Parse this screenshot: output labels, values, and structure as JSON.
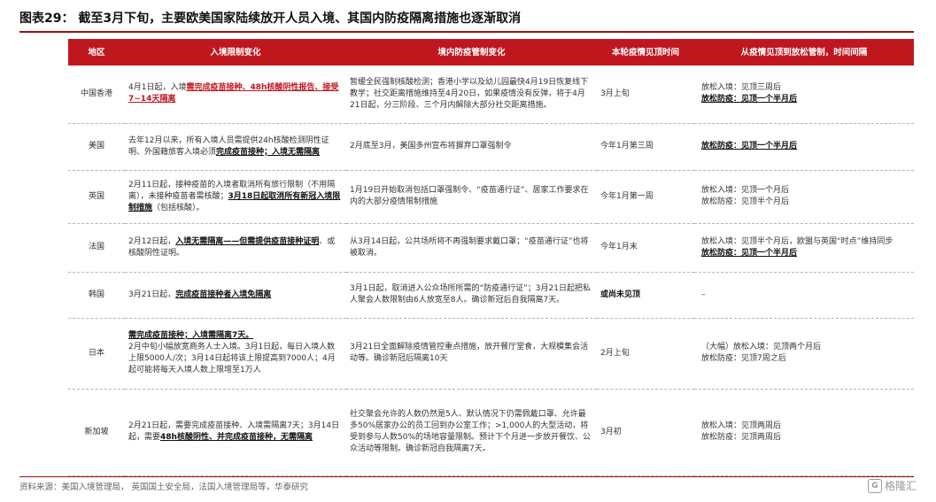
{
  "title": "图表29： 截至3月下旬，主要欧美国家陆续放开人员入境、其国内防疫隔离措施也逐渐取消",
  "headers": [
    "地区",
    "入境限制变化",
    "境内防疫管制变化",
    "本轮疫情见顶时间",
    "从疫情见顶到放松管制，时间间隔"
  ],
  "rows": [
    {
      "region": "中国香港",
      "entry": [
        {
          "t": "4月1日起，入境",
          "s": ""
        },
        {
          "t": "需完成疫苗接种、48h核酸阴性报告、接受7~14天隔离",
          "s": "r"
        }
      ],
      "domestic": [
        {
          "t": "暂缓全民强制核酸检测；香港小学以及幼儿园最快4月19日恢复线下教学；社交距离措施维持至4月20日，如果疫情没有反弹，将于4月21日起，分三阶段、三个月内解除大部分社交距离措施。",
          "s": ""
        }
      ],
      "peak": [
        {
          "t": "3月上旬",
          "s": ""
        }
      ],
      "interval": [
        {
          "t": "放松入境：见顶三周后",
          "s": ""
        },
        {
          "t": "放松防疫：见顶一个半月后",
          "s": "u",
          "br": true
        }
      ]
    },
    {
      "region": "美国",
      "entry": [
        {
          "t": "去年12月以来，所有入境人员需提供24h核酸检测阴性证明、外国籍旅客入境必须",
          "s": ""
        },
        {
          "t": "完成疫苗接种；入境无需隔离",
          "s": "u"
        }
      ],
      "domestic": [
        {
          "t": "2月底至3月，美国多州宣布将摒弃口罩强制令",
          "s": ""
        }
      ],
      "peak": [
        {
          "t": "今年1月第三周",
          "s": ""
        }
      ],
      "interval": [
        {
          "t": "放松防疫：见顶一个半月后",
          "s": "u"
        }
      ]
    },
    {
      "region": "英国",
      "entry": [
        {
          "t": "2月11日起，接种疫苗的入境者取消所有旅行限制（不用隔离），未接种疫苗者需核酸；",
          "s": ""
        },
        {
          "t": "3月18日起取消所有新冠入境限制措施",
          "s": "u"
        },
        {
          "t": "（包括核酸）。",
          "s": ""
        }
      ],
      "domestic": [
        {
          "t": "1月19日开始取消包括口罩强制令、“疫苗通行证”、居家工作要求在内的大部分疫情限制措施",
          "s": ""
        }
      ],
      "peak": [
        {
          "t": "今年1月第一周",
          "s": ""
        }
      ],
      "interval": [
        {
          "t": "放松入境：见顶一个月后",
          "s": ""
        },
        {
          "t": "放松防疫：见顶半个月后",
          "s": "",
          "br": true
        }
      ]
    },
    {
      "region": "法国",
      "entry": [
        {
          "t": "2月12日起，",
          "s": ""
        },
        {
          "t": "入境无需隔离——但需提供疫苗接种证明",
          "s": "u"
        },
        {
          "t": "、或核酸阴性证明。",
          "s": ""
        }
      ],
      "domestic": [
        {
          "t": "从3月14日起，公共场所将不再强制要求戴口罩；“疫苗通行证”也将被取消。",
          "s": ""
        }
      ],
      "peak": [
        {
          "t": "今年1月末",
          "s": ""
        }
      ],
      "interval": [
        {
          "t": "放松入境：见顶半个月后，欧盟与英国“时点”维持同步",
          "s": ""
        },
        {
          "t": "放松防疫：见顶一个半月后",
          "s": "u",
          "br": true
        }
      ]
    },
    {
      "region": "韩国",
      "entry": [
        {
          "t": "3月21日起，",
          "s": ""
        },
        {
          "t": "完成疫苗接种者入境免隔离",
          "s": "u"
        }
      ],
      "domestic": [
        {
          "t": "3月1日起，取消进入公众场所所需的“防疫通行证”；3月21日起把私人聚会人数限制由6人放宽至8人。确诊新冠后自我隔离7天。",
          "s": ""
        }
      ],
      "peak": [
        {
          "t": "或尚未见顶",
          "s": "b"
        }
      ],
      "interval": [
        {
          "t": "–",
          "s": ""
        }
      ]
    },
    {
      "region": "日本",
      "entry": [
        {
          "t": "需完成疫苗接种；入境需隔离7天。",
          "s": "u"
        },
        {
          "t": "2月中旬小幅放宽商务人士入境。3月1日起，每日入境人数上限5000人/次；3月14日起将该上限提高到7000人；4月起可能将每天入境人数上限增至1万人",
          "s": "",
          "br": true
        }
      ],
      "domestic": [
        {
          "t": "3月21日全面解除疫情管控重点措施，放开餐厅堂食，大规模集会活动等。确诊新冠后隔离10天",
          "s": ""
        }
      ],
      "peak": [
        {
          "t": "2月上旬",
          "s": ""
        }
      ],
      "interval": [
        {
          "t": "（大幅）放松入境：见顶两个月后",
          "s": ""
        },
        {
          "t": "放松防疫：见顶7周之后",
          "s": "",
          "br": true
        }
      ]
    },
    {
      "region": "新加坡",
      "entry": [
        {
          "t": "2月21日起，需要完成疫苗接种、入境需隔离7天；3月14日起，需要",
          "s": ""
        },
        {
          "t": "48h核酸阴性、并完成疫苗接种，无需隔离",
          "s": "u"
        }
      ],
      "domestic": [
        {
          "t": "社交聚会允许的人数仍然是5人、默认情况下仍需佩戴口罩、允许最多50%居家办公的员工回到办公室工作；>1,000人的大型活动，将受到参与人数50%的场地容量限制。预计下个月进一步放开餐饮、公众活动等限制。确诊新冠自我隔离7天。",
          "s": ""
        }
      ],
      "peak": [
        {
          "t": "3月初",
          "s": ""
        }
      ],
      "interval": [
        {
          "t": "放松入境：见顶两周后",
          "s": ""
        },
        {
          "t": "放松防疫：见顶两周后",
          "s": "",
          "br": true
        }
      ]
    }
  ],
  "source_note": "资料来源：美国入境管理局， 英国国土安全局，法国入境管理局等，华泰研究",
  "watermark": "格隆汇"
}
